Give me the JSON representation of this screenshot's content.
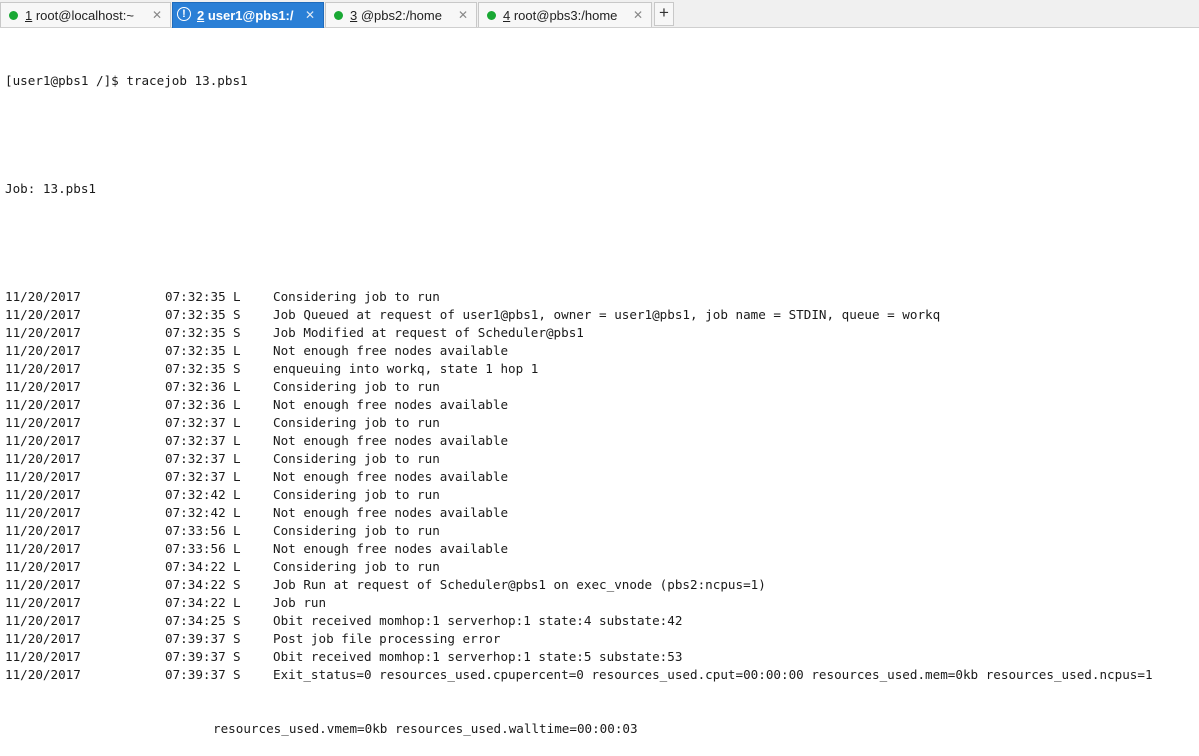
{
  "tabs": [
    {
      "num": "1",
      "label": " root@localhost:~",
      "status": "connected"
    },
    {
      "num": "2",
      "label": " user1@pbs1:/",
      "status": "warning"
    },
    {
      "num": "3",
      "label": " @pbs2:/home",
      "status": "connected"
    },
    {
      "num": "4",
      "label": " root@pbs3:/home",
      "status": "connected"
    }
  ],
  "new_tab_label": "+",
  "terminal": {
    "prompt_line": "[user1@pbs1 /]$ tracejob 13.pbs1",
    "job_line": "Job: 13.pbs1",
    "entries": [
      {
        "date": "11/20/2017",
        "time": "07:32:35",
        "type": "L",
        "msg": "Considering job to run"
      },
      {
        "date": "11/20/2017",
        "time": "07:32:35",
        "type": "S",
        "msg": "Job Queued at request of user1@pbs1, owner = user1@pbs1, job name = STDIN, queue = workq"
      },
      {
        "date": "11/20/2017",
        "time": "07:32:35",
        "type": "S",
        "msg": "Job Modified at request of Scheduler@pbs1"
      },
      {
        "date": "11/20/2017",
        "time": "07:32:35",
        "type": "L",
        "msg": "Not enough free nodes available"
      },
      {
        "date": "11/20/2017",
        "time": "07:32:35",
        "type": "S",
        "msg": "enqueuing into workq, state 1 hop 1"
      },
      {
        "date": "11/20/2017",
        "time": "07:32:36",
        "type": "L",
        "msg": "Considering job to run"
      },
      {
        "date": "11/20/2017",
        "time": "07:32:36",
        "type": "L",
        "msg": "Not enough free nodes available"
      },
      {
        "date": "11/20/2017",
        "time": "07:32:37",
        "type": "L",
        "msg": "Considering job to run"
      },
      {
        "date": "11/20/2017",
        "time": "07:32:37",
        "type": "L",
        "msg": "Not enough free nodes available"
      },
      {
        "date": "11/20/2017",
        "time": "07:32:37",
        "type": "L",
        "msg": "Considering job to run"
      },
      {
        "date": "11/20/2017",
        "time": "07:32:37",
        "type": "L",
        "msg": "Not enough free nodes available"
      },
      {
        "date": "11/20/2017",
        "time": "07:32:42",
        "type": "L",
        "msg": "Considering job to run"
      },
      {
        "date": "11/20/2017",
        "time": "07:32:42",
        "type": "L",
        "msg": "Not enough free nodes available"
      },
      {
        "date": "11/20/2017",
        "time": "07:33:56",
        "type": "L",
        "msg": "Considering job to run"
      },
      {
        "date": "11/20/2017",
        "time": "07:33:56",
        "type": "L",
        "msg": "Not enough free nodes available"
      },
      {
        "date": "11/20/2017",
        "time": "07:34:22",
        "type": "L",
        "msg": "Considering job to run"
      },
      {
        "date": "11/20/2017",
        "time": "07:34:22",
        "type": "S",
        "msg": "Job Run at request of Scheduler@pbs1 on exec_vnode (pbs2:ncpus=1)"
      },
      {
        "date": "11/20/2017",
        "time": "07:34:22",
        "type": "L",
        "msg": "Job run"
      },
      {
        "date": "11/20/2017",
        "time": "07:34:25",
        "type": "S",
        "msg": "Obit received momhop:1 serverhop:1 state:4 substate:42"
      },
      {
        "date": "11/20/2017",
        "time": "07:39:37",
        "type": "S",
        "msg": "Post job file processing error"
      },
      {
        "date": "11/20/2017",
        "time": "07:39:37",
        "type": "S",
        "msg": "Obit received momhop:1 serverhop:1 state:5 substate:53"
      },
      {
        "date": "11/20/2017",
        "time": "07:39:37",
        "type": "S",
        "msg": "Exit_status=0 resources_used.cpupercent=0 resources_used.cput=00:00:00 resources_used.mem=0kb resources_used.ncpus=1"
      }
    ],
    "wrap_line": "resources_used.vmem=0kb resources_used.walltime=00:00:03"
  }
}
